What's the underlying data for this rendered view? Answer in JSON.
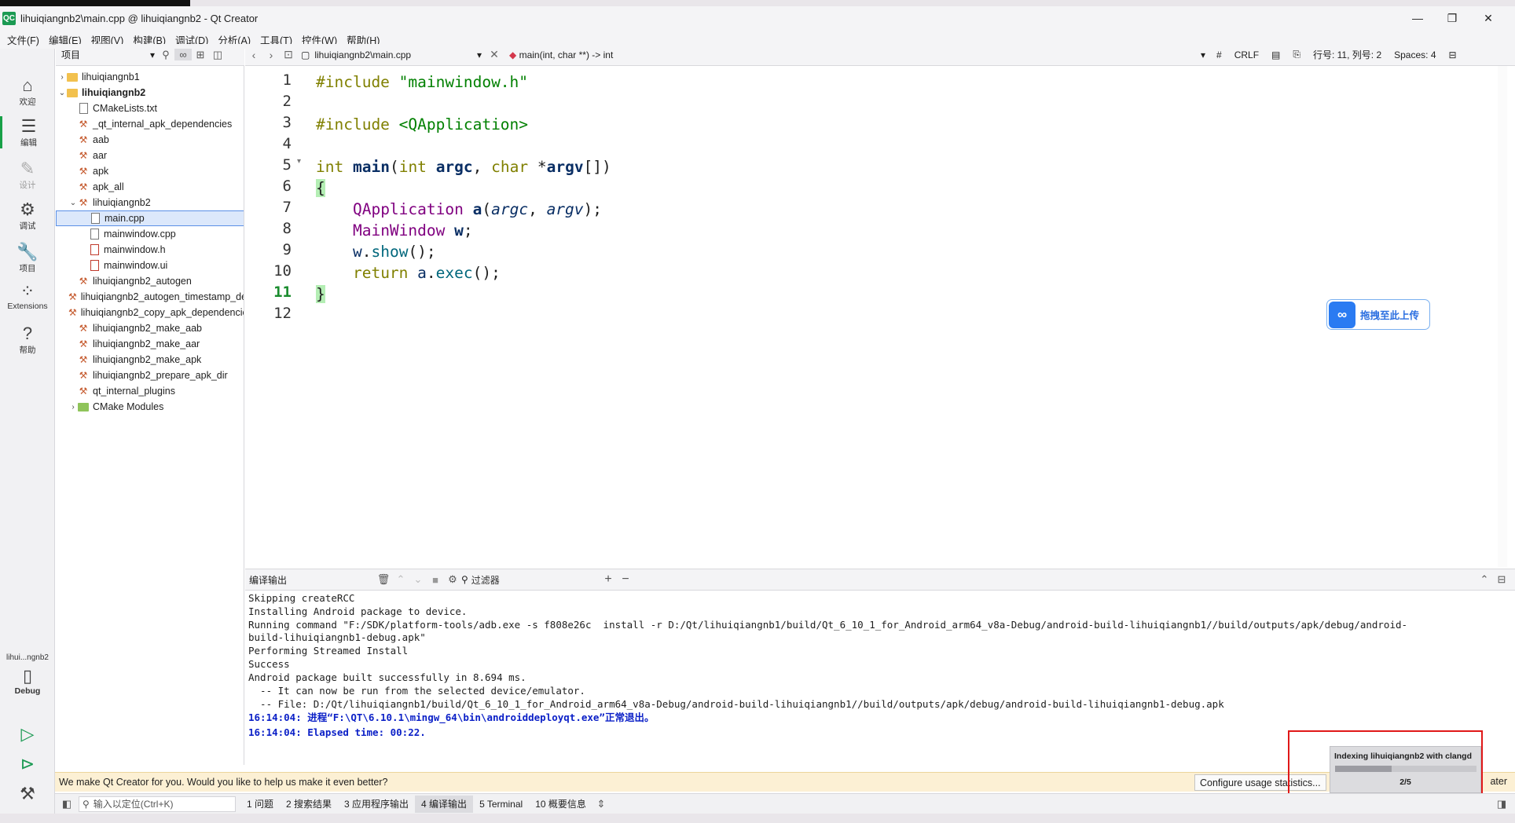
{
  "window": {
    "logo": "QC",
    "title": "lihuiqiangnb2\\main.cpp @ lihuiqiangnb2 - Qt Creator",
    "min": "—",
    "max": "❐",
    "close": "✕"
  },
  "menu": [
    "文件(F)",
    "编辑(E)",
    "视图(V)",
    "构建(B)",
    "调试(D)",
    "分析(A)",
    "工具(T)",
    "控件(W)",
    "帮助(H)"
  ],
  "modes": [
    {
      "label": "欢迎",
      "icon": "home-icon"
    },
    {
      "label": "编辑",
      "icon": "edit-icon"
    },
    {
      "label": "设计",
      "icon": "pen-icon"
    },
    {
      "label": "调试",
      "icon": "bug-icon"
    },
    {
      "label": "项目",
      "icon": "wrench-icon"
    },
    {
      "label": "Extensions",
      "icon": "extensions-icon"
    },
    {
      "label": "帮助",
      "icon": "help-icon"
    }
  ],
  "kit": {
    "project": "lihui...ngnb2",
    "build": "Debug"
  },
  "project_panel": {
    "selector": "项目",
    "tree": [
      {
        "label": "lihuiqiangnb1",
        "type": "folder",
        "depth": 0,
        "arrow": "›"
      },
      {
        "label": "lihuiqiangnb2",
        "type": "folder",
        "depth": 0,
        "arrow": "⌄",
        "bold": true
      },
      {
        "label": "CMakeLists.txt",
        "type": "file",
        "depth": 1
      },
      {
        "label": "_qt_internal_apk_dependencies",
        "type": "target",
        "depth": 1
      },
      {
        "label": "aab",
        "type": "target",
        "depth": 1
      },
      {
        "label": "aar",
        "type": "target",
        "depth": 1
      },
      {
        "label": "apk",
        "type": "target",
        "depth": 1
      },
      {
        "label": "apk_all",
        "type": "target",
        "depth": 1
      },
      {
        "label": "lihuiqiangnb2",
        "type": "target",
        "depth": 1,
        "arrow": "⌄"
      },
      {
        "label": "main.cpp",
        "type": "file",
        "depth": 2,
        "selected": true
      },
      {
        "label": "mainwindow.cpp",
        "type": "file",
        "depth": 2
      },
      {
        "label": "mainwindow.h",
        "type": "file-red",
        "depth": 2
      },
      {
        "label": "mainwindow.ui",
        "type": "file-red",
        "depth": 2
      },
      {
        "label": "lihuiqiangnb2_autogen",
        "type": "target",
        "depth": 1
      },
      {
        "label": "lihuiqiangnb2_autogen_timestamp_deps",
        "type": "target",
        "depth": 1
      },
      {
        "label": "lihuiqiangnb2_copy_apk_dependencies",
        "type": "target",
        "depth": 1
      },
      {
        "label": "lihuiqiangnb2_make_aab",
        "type": "target",
        "depth": 1
      },
      {
        "label": "lihuiqiangnb2_make_aar",
        "type": "target",
        "depth": 1
      },
      {
        "label": "lihuiqiangnb2_make_apk",
        "type": "target",
        "depth": 1
      },
      {
        "label": "lihuiqiangnb2_prepare_apk_dir",
        "type": "target",
        "depth": 1
      },
      {
        "label": "qt_internal_plugins",
        "type": "target",
        "depth": 1
      },
      {
        "label": "CMake Modules",
        "type": "folder-green",
        "depth": 1,
        "arrow": "›"
      }
    ]
  },
  "editor_toolbar": {
    "file": "lihuiqiangnb2\\main.cpp",
    "symbol": "main(int, char **) -> int",
    "hash": "#",
    "line_ending": "CRLF",
    "position": "行号: 11, 列号: 2",
    "indent": "Spaces: 4"
  },
  "editor": {
    "line_numbers": [
      "1",
      "2",
      "3",
      "4",
      "5",
      "6",
      "7",
      "8",
      "9",
      "10",
      "11",
      "12"
    ],
    "current_line": "11"
  },
  "upload": {
    "label": "拖拽至此上传"
  },
  "output": {
    "title": "编译输出",
    "filter_placeholder": "过滤器",
    "lines": [
      "Skipping createRCC",
      "Installing Android package to device.",
      "Running command \"F:/SDK/platform-tools/adb.exe -s f808e26c  install -r D:/Qt/lihuiqiangnb1/build/Qt_6_10_1_for_Android_arm64_v8a-Debug/android-build-lihuiqiangnb1//build/outputs/apk/debug/android-",
      "build-lihuiqiangnb1-debug.apk\"",
      "Performing Streamed Install",
      "Success",
      "Android package built successfully in 8.694 ms.",
      "  -- It can now be run from the selected device/emulator.",
      "  -- File: D:/Qt/lihuiqiangnb1/build/Qt_6_10_1_for_Android_arm64_v8a-Debug/android-build-lihuiqiangnb1//build/outputs/apk/debug/android-build-lihuiqiangnb1-debug.apk"
    ],
    "status_lines": [
      "16:14:04: 进程“F:\\QT\\6.10.1\\mingw_64\\bin\\androiddeployqt.exe”正常退出。",
      "16:14:04: Elapsed time: 00:22."
    ]
  },
  "indexing": {
    "title": "Indexing lihuiqiangnb2 with clangd",
    "progress": "2/5",
    "fraction": 0.4
  },
  "info_bar": {
    "message": "We make Qt Creator for you. Would you like to help us make it even better?",
    "configure": "Configure usage statistics...",
    "later": "ater"
  },
  "status_bar": {
    "locator_placeholder": "输入以定位(Ctrl+K)",
    "tabs": [
      "1 问题",
      "2 搜索结果",
      "3 应用程序输出",
      "4 编译输出",
      "5 Terminal",
      "10 概要信息"
    ],
    "active_tab": 3
  }
}
